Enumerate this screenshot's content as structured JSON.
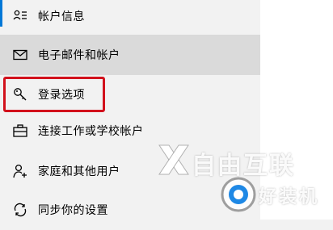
{
  "nav": {
    "items": [
      {
        "label": "帐户信息",
        "icon": "account-info-icon"
      },
      {
        "label": "电子邮件和帐户",
        "icon": "mail-icon"
      },
      {
        "label": "登录选项",
        "icon": "key-icon"
      },
      {
        "label": "连接工作或学校帐户",
        "icon": "briefcase-icon"
      },
      {
        "label": "家庭和其他用户",
        "icon": "person-add-icon"
      },
      {
        "label": "同步你的设置",
        "icon": "sync-icon"
      }
    ],
    "selected_index": 0,
    "hovered_index": 1,
    "highlighted_index": 2
  },
  "watermark": {
    "brand": "自由互联",
    "sub": "好装机",
    "colors": {
      "logo_blue": "#1e88e5",
      "logo_gray": "#9e9e9e"
    }
  },
  "colors": {
    "accent": "#0078d7",
    "highlight_border": "#d2111c",
    "hover_bg": "#dadada",
    "nav_bg": "#f2f2f2"
  }
}
